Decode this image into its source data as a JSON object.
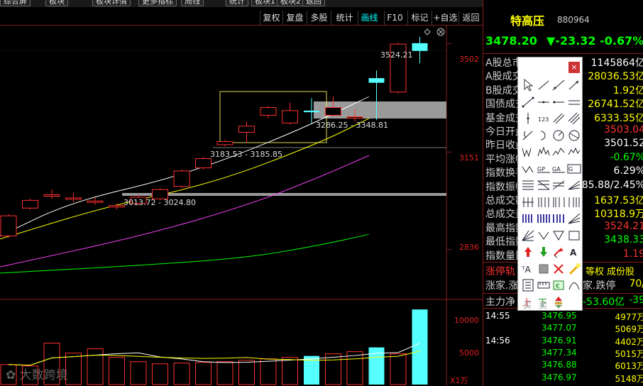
{
  "toolbar": {
    "top_buttons": [
      "综合屏",
      "板块",
      "板块详情",
      "更多指标",
      "周线",
      "统计",
      "板块1",
      "板块2",
      "返回"
    ],
    "buttons": [
      "复权",
      "复盘",
      "多股",
      "统计",
      "画线",
      "F10",
      "标记",
      "+自选",
      "返回"
    ],
    "active": "画线"
  },
  "stock": {
    "name": "特高压",
    "code": "880964",
    "price": "3478.20",
    "change": "▼-23.32",
    "pct": "-0.67%"
  },
  "stats": [
    {
      "label": "A股总市值",
      "value": "1145864亿",
      "color": "#ffffff"
    },
    {
      "label": "A股成交",
      "value": "28036.53亿",
      "color": "#ffff00"
    },
    {
      "label": "B股成交",
      "value": "1.92亿",
      "color": "#ffff00"
    },
    {
      "label": "国债成交",
      "value": "26741.52亿",
      "color": "#ffff00"
    },
    {
      "label": "基金成交",
      "value": "6333.35亿",
      "color": "#ffff00"
    },
    {
      "label": "今日开盘",
      "value": "3503.04",
      "color": "#ff3333"
    },
    {
      "label": "昨日收盘",
      "value": "3501.52",
      "color": "#ffffff"
    },
    {
      "label": "平均涨幅",
      "value": "-0.67%",
      "color": "#00ff00"
    },
    {
      "label": "指数换手",
      "value": "6.29%",
      "color": "#ffffff"
    },
    {
      "label": "指数振幅",
      "value": "85.88/2.45%",
      "color": "#ffffff"
    },
    {
      "label": "总成交额",
      "value": "1637.53亿",
      "color": "#ffff00"
    },
    {
      "label": "总成交量",
      "value": "10318.9万",
      "color": "#ffff00"
    },
    {
      "label": "最高指数",
      "value": "3524.21",
      "color": "#ff3333"
    },
    {
      "label": "最低指数",
      "value": "3438.33",
      "color": "#00ff00"
    },
    {
      "label": "指数量比",
      "value": "1.19",
      "color": "#ff3333"
    }
  ],
  "tabs": [
    "涨停轨",
    "等权",
    "成份股"
  ],
  "updown": {
    "label": "涨家.涨",
    "right": "家.跌停",
    "value": "70/"
  },
  "mainflow": {
    "label": "主力净",
    "value": "-53.60亿",
    "extra": "-39"
  },
  "ticks": [
    {
      "time": "14:55",
      "price": "3476.95",
      "vol": "4977万"
    },
    {
      "time": "",
      "price": "3477.07",
      "vol": "5069万"
    },
    {
      "time": "14:56",
      "price": "3476.91",
      "vol": "4402万"
    },
    {
      "time": "",
      "price": "3477.34",
      "vol": "5015万"
    },
    {
      "time": "",
      "price": "3476.88",
      "vol": "6013万"
    },
    {
      "time": "",
      "price": "3476.97",
      "vol": "5148万"
    }
  ],
  "axis": {
    "price_ticks": [
      "3502",
      "3151",
      "2836"
    ],
    "vol_ticks": [
      "10000",
      "5000"
    ],
    "vol_unit": "X1万"
  },
  "annotations": {
    "high": "3524.21",
    "range1": "3286.25 - 3348.81",
    "range2": "3183.53 - 3185.85",
    "range3": "3013.72 - 3024.80"
  },
  "palette": {
    "close_label": "×",
    "bottom_labels": [
      "买",
      "卖",
      "平"
    ],
    "tools": [
      "cursor-icon",
      "line-segment-icon",
      "line-icon",
      "ray-icon",
      "arrow-line-icon",
      "horizontal-line-icon",
      "horizontal-ray-icon",
      "parallel-icon",
      "vertical-line-icon",
      "number-icon",
      "channel-icon",
      "parallel-channel-icon",
      "arc-icon",
      "circle-arc-icon",
      "circle-icon",
      "ellipse-icon",
      "wave-icon",
      "wave2-icon",
      "wave3-icon",
      "wave4-icon",
      "wave5-icon",
      "gp-icon",
      "ga-icon",
      "gc-icon",
      "fib-icon",
      "fib2-icon",
      "fib3-icon",
      "fib4-icon",
      "cycle-icon",
      "cycle2-icon",
      "cycle3-icon",
      "cycle4-icon",
      "bars-icon",
      "bars2-icon",
      "bars3-icon",
      "gann-icon",
      "fan-icon",
      "v-icon",
      "triangle-icon",
      "rect-icon",
      "up-arrow-icon",
      "down-arrow-icon",
      "flag-icon",
      "text-icon",
      "text2-icon",
      "box-icon",
      "delete-icon",
      "brush-icon",
      "doc-icon",
      "ruler-icon",
      "screenshot-icon",
      "arch-icon",
      "buy-icon",
      "sell-icon",
      "flat-icon"
    ],
    "colors": {
      "up": "#e02020",
      "down": "#20a020"
    }
  },
  "watermark": "大数跨境",
  "chart_data": {
    "type": "candlestick",
    "price_ylim": [
      2700,
      3560
    ],
    "candles": [
      {
        "o": 2880,
        "c": 2945,
        "h": 2950,
        "l": 2875
      },
      {
        "o": 2970,
        "c": 2995,
        "h": 3000,
        "l": 2965
      },
      {
        "o": 3010,
        "c": 3013,
        "h": 3030,
        "l": 3000
      },
      {
        "o": 3000,
        "c": 3003,
        "h": 3020,
        "l": 2990
      },
      {
        "o": 2990,
        "c": 2993,
        "h": 3005,
        "l": 2980
      },
      {
        "o": 2975,
        "c": 2978,
        "h": 2985,
        "l": 2965
      },
      {
        "o": 2985,
        "c": 3005,
        "h": 3015,
        "l": 2980
      },
      {
        "o": 3000,
        "c": 3030,
        "h": 3035,
        "l": 2995
      },
      {
        "o": 3040,
        "c": 3090,
        "h": 3095,
        "l": 3035
      },
      {
        "o": 3100,
        "c": 3130,
        "h": 3135,
        "l": 3095
      },
      {
        "o": 3175,
        "c": 3185,
        "h": 3190,
        "l": 3170
      },
      {
        "o": 3215,
        "c": 3235,
        "h": 3250,
        "l": 3180
      },
      {
        "o": 3270,
        "c": 3295,
        "h": 3300,
        "l": 3260
      },
      {
        "o": 3245,
        "c": 3285,
        "h": 3310,
        "l": 3240
      },
      {
        "o": 3285,
        "c": 3280,
        "h": 3325,
        "l": 3245
      },
      {
        "o": 3270,
        "c": 3295,
        "h": 3330,
        "l": 3265
      },
      {
        "o": 3265,
        "c": 3265,
        "h": 3290,
        "l": 3250
      },
      {
        "o": 3390,
        "c": 3375,
        "h": 3415,
        "l": 3255
      },
      {
        "o": 3345,
        "c": 3500,
        "h": 3505,
        "l": 3340
      },
      {
        "o": 3503,
        "c": 3478,
        "h": 3524,
        "l": 3438
      }
    ],
    "volume_ylim": [
      0,
      12000
    ],
    "volume": [
      2800,
      2600,
      5800,
      4400,
      5000,
      3800,
      3200,
      2900,
      3000,
      3100,
      3200,
      3400,
      3600,
      3800,
      4000,
      4300,
      4600,
      5200,
      4300,
      10500
    ]
  }
}
